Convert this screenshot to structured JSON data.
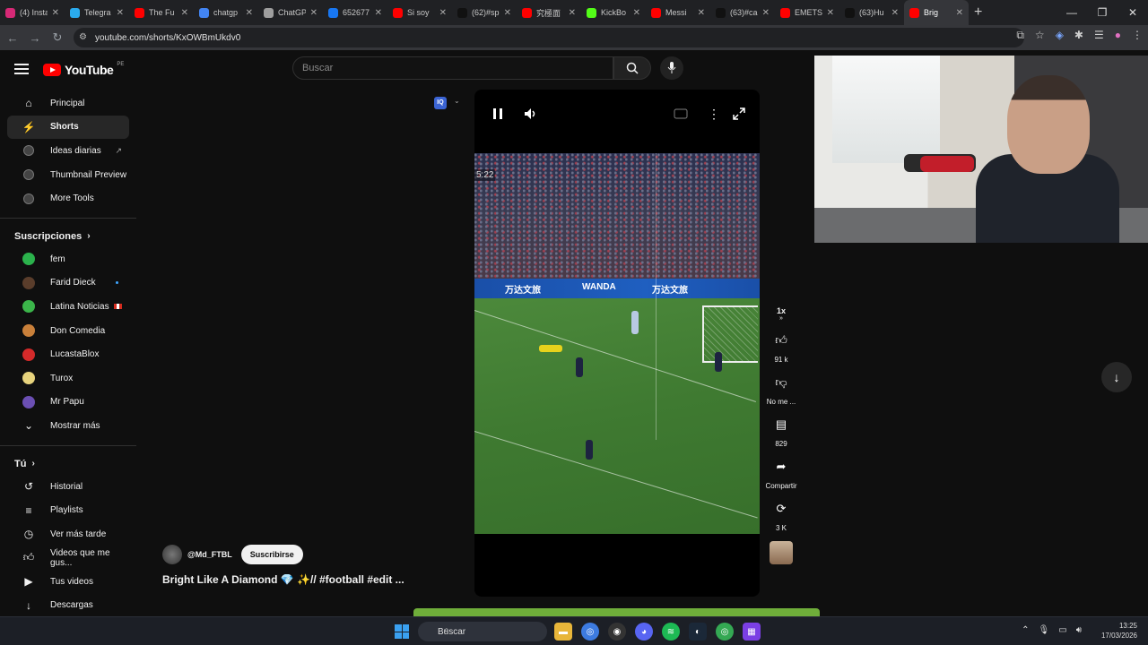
{
  "browser": {
    "tabs": [
      {
        "title": "(4) Insta",
        "color": "#d62976"
      },
      {
        "title": "Telegra",
        "color": "#2aabee"
      },
      {
        "title": "The Fu",
        "color": "#ff0000"
      },
      {
        "title": "chatgp",
        "color": "#4285f4"
      },
      {
        "title": "ChatGP",
        "color": "#9e9e9e"
      },
      {
        "title": "652677",
        "color": "#1877f2"
      },
      {
        "title": "Si soy",
        "color": "#ff0000"
      },
      {
        "title": "(62)#sp",
        "color": "#111111"
      },
      {
        "title": "究極面",
        "color": "#ff0000"
      },
      {
        "title": "KickBo",
        "color": "#53fc18"
      },
      {
        "title": "Messi",
        "color": "#ff0000"
      },
      {
        "title": "(63)#ca",
        "color": "#111111"
      },
      {
        "title": "EMETS",
        "color": "#ff0000"
      },
      {
        "title": "(63)Hu",
        "color": "#111111"
      },
      {
        "title": "Brig",
        "color": "#ff0000"
      }
    ],
    "url": "youtube.com/shorts/KxOWBmUkdv0"
  },
  "youtube": {
    "logo_text": "YouTube",
    "region": "PE",
    "search_placeholder": "Buscar",
    "sidebar": {
      "main": [
        {
          "label": "Principal",
          "icon": "home-icon"
        },
        {
          "label": "Shorts",
          "icon": "shorts-icon"
        },
        {
          "label": "Ideas diarias",
          "icon": "extension-icon"
        },
        {
          "label": "Thumbnail Preview",
          "icon": "extension-icon"
        },
        {
          "label": "More Tools",
          "icon": "extension-icon"
        }
      ],
      "subscriptions_title": "Suscripciones",
      "subscriptions": [
        {
          "label": "fem",
          "color": "#2bb24c"
        },
        {
          "label": "Farid Dieck",
          "color": "#5a3d2b"
        },
        {
          "label": "Latina Noticias",
          "color": "#3bb54a"
        },
        {
          "label": "Don Comedia",
          "color": "#c9803a"
        },
        {
          "label": "LucastaBlox",
          "color": "#d42a2a"
        },
        {
          "label": "Turox",
          "color": "#e7d37d"
        },
        {
          "label": "Mr Papu",
          "color": "#6b4fb3"
        }
      ],
      "show_more": "Mostrar más",
      "you_title": "Tú",
      "you": [
        {
          "label": "Historial",
          "icon": "history-icon"
        },
        {
          "label": "Playlists",
          "icon": "playlist-icon"
        },
        {
          "label": "Ver más tarde",
          "icon": "clock-icon"
        },
        {
          "label": "Videos que me gus...",
          "icon": "like-icon"
        },
        {
          "label": "Tus videos",
          "icon": "video-icon"
        },
        {
          "label": "Descargas",
          "icon": "download-icon"
        }
      ]
    },
    "short": {
      "score_overlay": "5:22",
      "board_text_1": "万达文旅",
      "board_text_2": "WANDA",
      "board_text_3": "万达文旅",
      "channel": "@Md_FTBL",
      "subscribe": "Suscribirse",
      "title": "Bright Like A Diamond 💎 ✨// #football #edit ...",
      "ext_badge": "IQ"
    },
    "actions": {
      "speed": "1x",
      "likes": "91 k",
      "dislike": "No me ...",
      "comments": "829",
      "share": "Compartir",
      "remix": "3 K"
    }
  },
  "taskbar": {
    "search": "Buscar",
    "time": "13:25",
    "date": "17/03/2026"
  }
}
